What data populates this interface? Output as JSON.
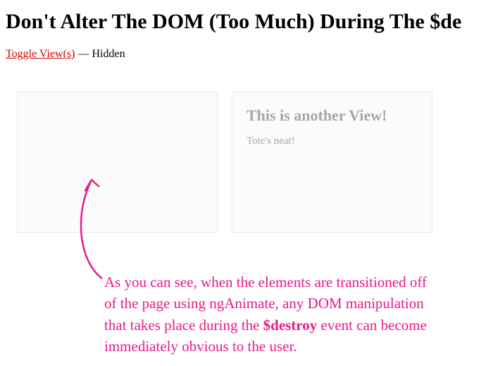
{
  "header": {
    "title": "Don't Alter The DOM (Too Much) During The $de"
  },
  "toggle": {
    "link_label": "Toggle View(s)",
    "separator": " — ",
    "state": "Hidden"
  },
  "views": {
    "left": {},
    "right": {
      "heading": "This is another View!",
      "body": "Tote's neat!"
    }
  },
  "annotation": {
    "line1": "As you can see, when the elements are transitioned off",
    "line2": "of the page using ngAnimate, any DOM manipulation",
    "line3_pre": "that takes place during the ",
    "line3_strong": "$destroy",
    "line3_post": " event can become",
    "line4": "immediately obvious to the user."
  }
}
